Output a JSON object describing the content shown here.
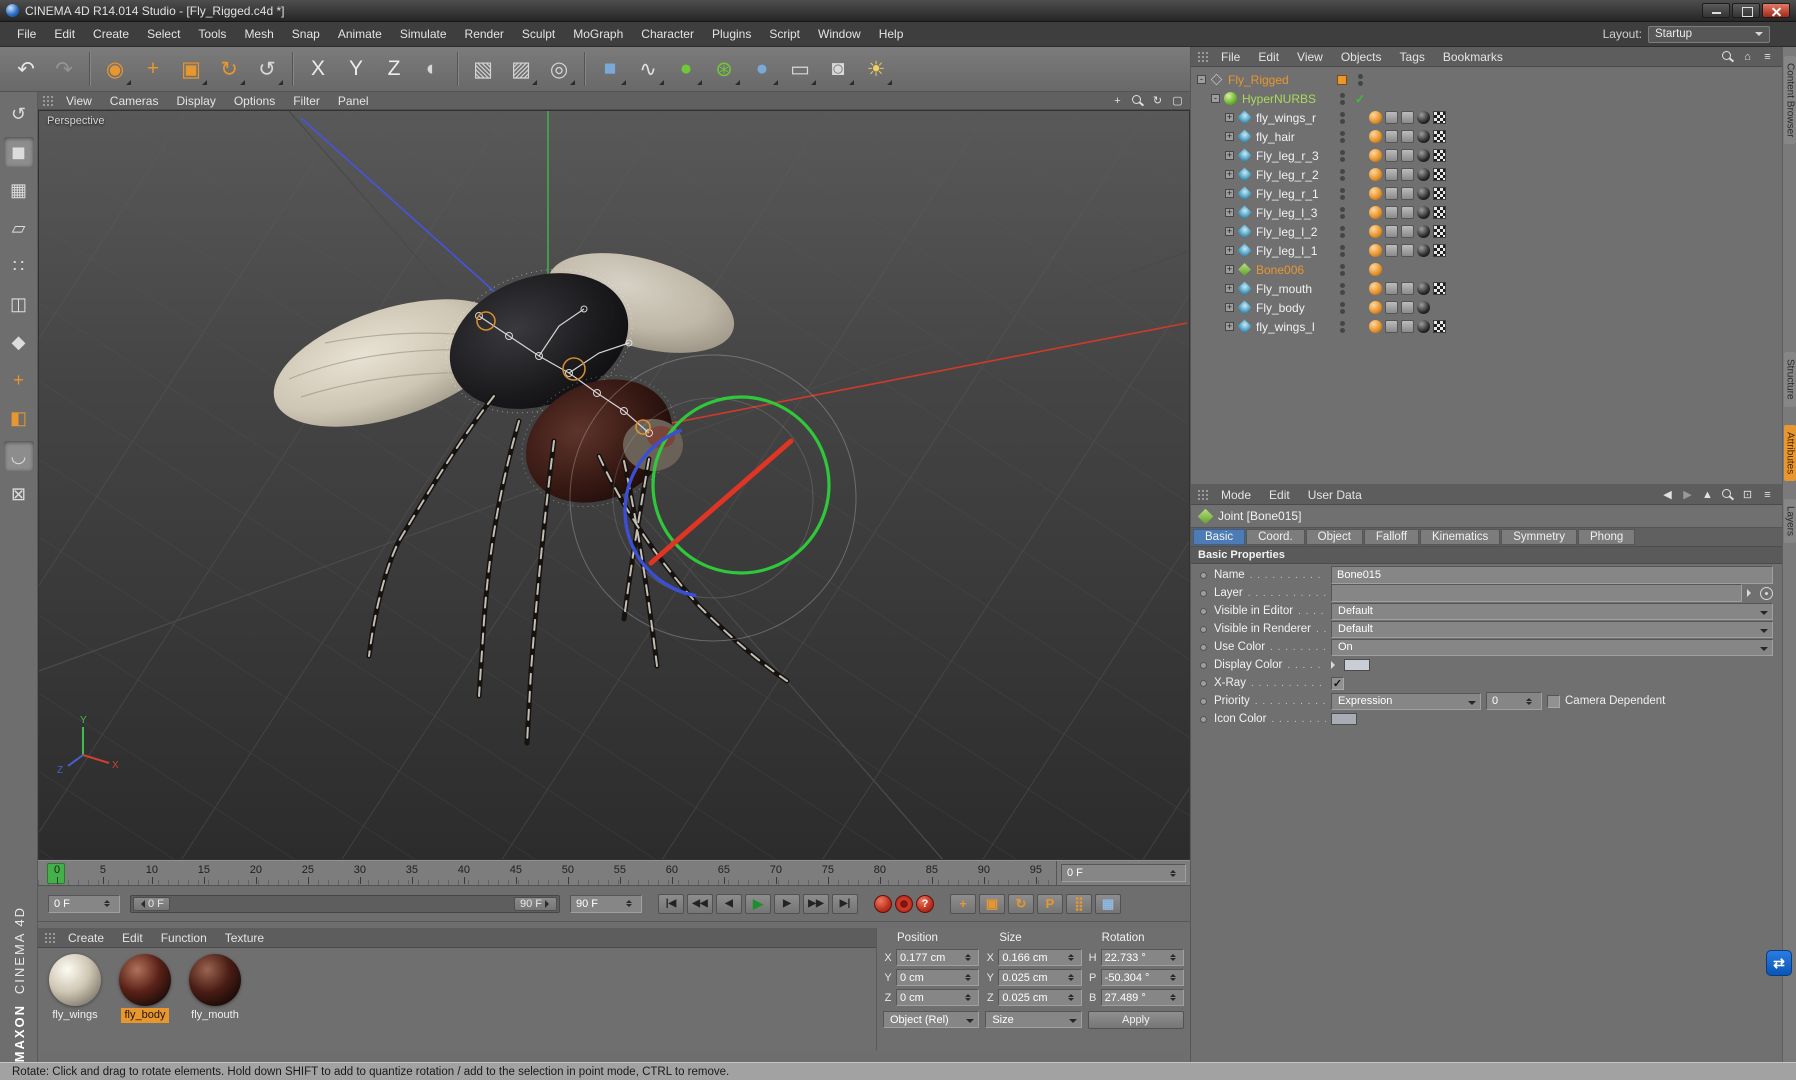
{
  "title_bar": {
    "title": "CINEMA 4D R14.014 Studio - [Fly_Rigged.c4d *]"
  },
  "menu_bar": {
    "items": [
      "File",
      "Edit",
      "Create",
      "Select",
      "Tools",
      "Mesh",
      "Snap",
      "Animate",
      "Simulate",
      "Render",
      "Sculpt",
      "MoGraph",
      "Character",
      "Plugins",
      "Script",
      "Window",
      "Help"
    ],
    "layout_label": "Layout:",
    "layout_value": "Startup"
  },
  "toolbar": {
    "buttons": [
      {
        "name": "undo-button",
        "glyph": "↶",
        "color": "#e6e6e6"
      },
      {
        "name": "redo-button",
        "glyph": "↷",
        "color": "#bdbdbd",
        "disabled": true
      },
      {
        "sep": true
      },
      {
        "name": "live-selection-button",
        "glyph": "◉",
        "color": "#e8962e",
        "corner": true
      },
      {
        "name": "move-tool-button",
        "glyph": "+",
        "color": "#e8962e"
      },
      {
        "name": "scale-tool-button",
        "glyph": "▣",
        "color": "#e8962e",
        "corner": true
      },
      {
        "name": "rotate-tool-button",
        "glyph": "↻",
        "color": "#e8962e",
        "corner": true
      },
      {
        "name": "last-used-tool-button",
        "glyph": "↺",
        "color": "#d8d8d8",
        "corner": true
      },
      {
        "sep": true
      },
      {
        "name": "lock-x-axis-button",
        "glyph": "X",
        "color": "#ececec"
      },
      {
        "name": "lock-y-axis-button",
        "glyph": "Y",
        "color": "#ececec"
      },
      {
        "name": "lock-z-axis-button",
        "glyph": "Z",
        "color": "#ececec"
      },
      {
        "name": "coordinate-system-button",
        "glyph": "◐",
        "color": "#d8d8d8"
      },
      {
        "sep": true
      },
      {
        "name": "render-view-button",
        "glyph": "▧",
        "color": "#d4d4d4"
      },
      {
        "name": "render-picture-viewer-button",
        "glyph": "▨",
        "color": "#d4d4d4",
        "corner": true
      },
      {
        "name": "render-settings-button",
        "glyph": "◎",
        "color": "#d4d4d4",
        "corner": true
      },
      {
        "sep": true
      },
      {
        "name": "add-primitive-button",
        "glyph": "■",
        "color": "#7aa9d8",
        "corner": true
      },
      {
        "name": "add-spline-button",
        "glyph": "∿",
        "color": "#e0e0e0",
        "corner": true
      },
      {
        "name": "add-nurbs-button",
        "glyph": "●",
        "color": "#71c837",
        "corner": true
      },
      {
        "name": "add-mograph-button",
        "glyph": "⊛",
        "color": "#71c837",
        "corner": true
      },
      {
        "name": "add-deformer-button",
        "glyph": "●",
        "color": "#7aa9d8",
        "corner": true
      },
      {
        "name": "add-environment-button",
        "glyph": "▭",
        "color": "#d8d8d8",
        "corner": true
      },
      {
        "name": "add-camera-button",
        "glyph": "◙",
        "color": "#d8d8d8",
        "corner": true
      },
      {
        "name": "add-light-button",
        "glyph": "☀",
        "color": "#f0d060",
        "corner": true
      }
    ]
  },
  "left_palette": {
    "buttons": [
      {
        "name": "make-editable-button",
        "glyph": "↺"
      },
      {
        "name": "model-mode-button",
        "glyph": "◼",
        "active": true
      },
      {
        "name": "texture-mode-button",
        "glyph": "▦"
      },
      {
        "name": "workplane-mode-button",
        "glyph": "▱"
      },
      {
        "name": "points-mode-button",
        "glyph": "∷"
      },
      {
        "name": "edges-mode-button",
        "glyph": "◫"
      },
      {
        "name": "polygons-mode-button",
        "glyph": "◆"
      },
      {
        "name": "axis-mode-button",
        "glyph": "+",
        "color": "#e8962e"
      },
      {
        "name": "texture-axis-mode-button",
        "glyph": "◧",
        "color": "#e8962e"
      },
      {
        "name": "enable-snap-button",
        "glyph": "◡",
        "active": true
      },
      {
        "name": "lock-workplane-button",
        "glyph": "⊠"
      }
    ]
  },
  "viewport": {
    "menus": [
      "View",
      "Cameras",
      "Display",
      "Options",
      "Filter",
      "Panel"
    ],
    "view_label": "Perspective",
    "icons": [
      {
        "name": "pan-view-icon",
        "glyph": "+"
      },
      {
        "name": "zoom-view-icon",
        "type": "mag"
      },
      {
        "name": "rotate-view-icon",
        "glyph": "↻"
      },
      {
        "name": "toggle-view-icon",
        "glyph": "▢"
      }
    ],
    "axis_labels": {
      "x": "X",
      "y": "Y",
      "z": "Z"
    }
  },
  "object_manager": {
    "menus": [
      "File",
      "Edit",
      "View",
      "Objects",
      "Tags",
      "Bookmarks"
    ],
    "icons": [
      {
        "name": "search-icon",
        "type": "mag"
      },
      {
        "name": "home-icon",
        "glyph": "⌂"
      },
      {
        "name": "options-icon",
        "glyph": "≡"
      }
    ],
    "items": [
      {
        "name": "Fly_Rigged",
        "level": 0,
        "exp": "-",
        "icon": "null",
        "name_color": "#e8962e",
        "cols": [
          "swatch",
          "dots"
        ],
        "tags": []
      },
      {
        "name": "HyperNURBS",
        "level": 1,
        "exp": "-",
        "icon": "hypernurbs",
        "name_color": "#aada5c",
        "cols": [
          "dots",
          "check"
        ],
        "tags": []
      },
      {
        "name": "fly_wings_r",
        "level": 2,
        "exp": "+",
        "icon": "joint",
        "cols": [
          "dots",
          ""
        ],
        "tags": [
          "material",
          "chip",
          "chip",
          "sphere",
          "checker"
        ]
      },
      {
        "name": "fly_hair",
        "level": 2,
        "exp": "+",
        "icon": "joint",
        "cols": [
          "dots",
          ""
        ],
        "tags": [
          "material",
          "chip",
          "chip",
          "sphere",
          "checker"
        ]
      },
      {
        "name": "Fly_leg_r_3",
        "level": 2,
        "exp": "+",
        "icon": "joint",
        "cols": [
          "dots",
          ""
        ],
        "tags": [
          "material",
          "chip",
          "chip",
          "sphere",
          "checker"
        ]
      },
      {
        "name": "Fly_leg_r_2",
        "level": 2,
        "exp": "+",
        "icon": "joint",
        "cols": [
          "dots",
          ""
        ],
        "tags": [
          "material",
          "chip",
          "chip",
          "sphere",
          "checker"
        ]
      },
      {
        "name": "Fly_leg_r_1",
        "level": 2,
        "exp": "+",
        "icon": "joint",
        "cols": [
          "dots",
          ""
        ],
        "tags": [
          "material",
          "chip",
          "chip",
          "sphere",
          "checker"
        ]
      },
      {
        "name": "Fly_leg_l_3",
        "level": 2,
        "exp": "+",
        "icon": "joint",
        "cols": [
          "dots",
          ""
        ],
        "tags": [
          "material",
          "chip",
          "chip",
          "sphere",
          "checker"
        ]
      },
      {
        "name": "Fly_leg_l_2",
        "level": 2,
        "exp": "+",
        "icon": "joint",
        "cols": [
          "dots",
          ""
        ],
        "tags": [
          "material",
          "chip",
          "chip",
          "sphere",
          "checker"
        ]
      },
      {
        "name": "Fly_leg_l_1",
        "level": 2,
        "exp": "+",
        "icon": "joint",
        "cols": [
          "dots",
          ""
        ],
        "tags": [
          "material",
          "chip",
          "chip",
          "sphere",
          "checker"
        ]
      },
      {
        "name": "Bone006",
        "level": 2,
        "exp": "+",
        "icon": "bone",
        "name_color": "#e8962e",
        "cols": [
          "dots",
          ""
        ],
        "tags": [
          "material"
        ]
      },
      {
        "name": "Fly_mouth",
        "level": 2,
        "exp": "+",
        "icon": "joint",
        "cols": [
          "dots",
          ""
        ],
        "tags": [
          "material",
          "chip",
          "chip",
          "sphere",
          "checker"
        ]
      },
      {
        "name": "Fly_body",
        "level": 2,
        "exp": "+",
        "icon": "joint",
        "cols": [
          "dots",
          ""
        ],
        "tags": [
          "material",
          "chip",
          "chip",
          "sphere"
        ]
      },
      {
        "name": "fly_wings_l",
        "level": 2,
        "exp": "+",
        "icon": "joint",
        "cols": [
          "dots",
          ""
        ],
        "tags": [
          "material",
          "chip",
          "chip",
          "sphere",
          "checker"
        ]
      }
    ]
  },
  "attributes": {
    "menus": [
      "Mode",
      "Edit",
      "User Data"
    ],
    "icons": [
      {
        "name": "back-icon",
        "glyph": "◀"
      },
      {
        "name": "forward-icon",
        "glyph": "▶",
        "disabled": true
      },
      {
        "name": "pin-icon",
        "glyph": "▲"
      },
      {
        "name": "search-icon",
        "type": "mag"
      },
      {
        "name": "lock-icon",
        "glyph": "⊡"
      },
      {
        "name": "history-icon",
        "glyph": "≡"
      }
    ],
    "object_title": "Joint [Bone015]",
    "tabs": [
      {
        "label": "Basic",
        "active": true
      },
      {
        "label": "Coord."
      },
      {
        "label": "Object"
      },
      {
        "label": "Falloff"
      },
      {
        "label": "Kinematics"
      },
      {
        "label": "Symmetry"
      },
      {
        "label": "Phong"
      }
    ],
    "section_title": "Basic Properties",
    "rows": {
      "name_label": "Name",
      "name_value": "Bone015",
      "layer_label": "Layer",
      "layer_value": "",
      "visible_editor_label": "Visible in Editor",
      "visible_editor_value": "Default",
      "visible_renderer_label": "Visible in Renderer",
      "visible_renderer_value": "Default",
      "use_color_label": "Use Color",
      "use_color_value": "On",
      "display_color_label": "Display Color",
      "display_color_value": "#c9cdd6",
      "xray_label": "X-Ray",
      "priority_label": "Priority",
      "priority_value": "Expression",
      "priority_number": "0",
      "camera_dependent_label": "Camera Dependent",
      "icon_color_label": "Icon Color",
      "icon_color_value": "#a8adb5"
    }
  },
  "timeline": {
    "ruler_marks": [
      "0",
      "5",
      "10",
      "15",
      "20",
      "25",
      "30",
      "35",
      "40",
      "45",
      "50",
      "55",
      "60",
      "65",
      "70",
      "75",
      "80",
      "85",
      "90",
      "95"
    ],
    "frame_field": "0 F",
    "current_frame": "0 F",
    "range_start": "0 F",
    "range_end": "90 F",
    "end_frame": "90 F",
    "transport_buttons": [
      {
        "name": "goto-start-button",
        "glyph": "|◀"
      },
      {
        "name": "previous-key-button",
        "glyph": "◀◀"
      },
      {
        "name": "previous-frame-button",
        "glyph": "◀"
      },
      {
        "name": "play-button",
        "glyph": "▶",
        "type": "play"
      },
      {
        "name": "next-frame-button",
        "glyph": "▶"
      },
      {
        "name": "next-key-button",
        "glyph": "▶▶"
      },
      {
        "name": "goto-end-button",
        "glyph": "▶|"
      }
    ],
    "record_buttons": [
      {
        "name": "record-keyframe-button",
        "type": "red-solid"
      },
      {
        "name": "autokeying-button",
        "type": "red-ring"
      },
      {
        "name": "record-options-button",
        "type": "red-question",
        "glyph": "?"
      }
    ],
    "keying_toggles": [
      {
        "name": "key-position-toggle",
        "glyph": "+",
        "color": "#e8962e"
      },
      {
        "name": "key-scale-toggle",
        "glyph": "▣",
        "color": "#e8962e"
      },
      {
        "name": "key-rotation-toggle",
        "glyph": "↻",
        "color": "#e8962e"
      },
      {
        "name": "key-parameter-toggle",
        "glyph": "P",
        "color": "#e8962e"
      },
      {
        "name": "key-pla-toggle",
        "glyph": "⣿",
        "color": "#e8962e"
      },
      {
        "name": "keyframe-presets-button",
        "glyph": "▦",
        "color": "#8fb8e0"
      }
    ]
  },
  "materials": {
    "menus": [
      "Create",
      "Edit",
      "Function",
      "Texture"
    ],
    "items": [
      {
        "label": "fly_wings",
        "type": "light",
        "selected": false
      },
      {
        "label": "fly_body",
        "type": "dark-red",
        "selected": true
      },
      {
        "label": "fly_mouth",
        "type": "dark",
        "selected": false
      }
    ]
  },
  "coordinates": {
    "headers": [
      "Position",
      "Size",
      "Rotation"
    ],
    "position": {
      "labels": [
        "X",
        "Y",
        "Z"
      ],
      "values": [
        "0.177 cm",
        "0 cm",
        "0 cm"
      ]
    },
    "size": {
      "labels": [
        "X",
        "Y",
        "Z"
      ],
      "values": [
        "0.166 cm",
        "0.025 cm",
        "0.025 cm"
      ]
    },
    "rotation": {
      "labels": [
        "H",
        "P",
        "B"
      ],
      "values": [
        "22.733 °",
        "-50.304 °",
        "27.489 °"
      ]
    },
    "object_mode": "Object (Rel)",
    "size_mode": "Size",
    "apply_label": "Apply"
  },
  "right_strip": {
    "tabs": [
      {
        "label": "Content Browser"
      },
      {
        "label": "Structure"
      },
      {
        "label": "Attributes",
        "active": true
      },
      {
        "label": "Layers"
      }
    ]
  },
  "branding": {
    "maxon": "MAXON",
    "cinema": "CINEMA 4D"
  },
  "status_bar": {
    "text": "Rotate: Click and drag to rotate elements. Hold down SHIFT to add to quantize rotation / add to the selection in point mode, CTRL to remove."
  }
}
